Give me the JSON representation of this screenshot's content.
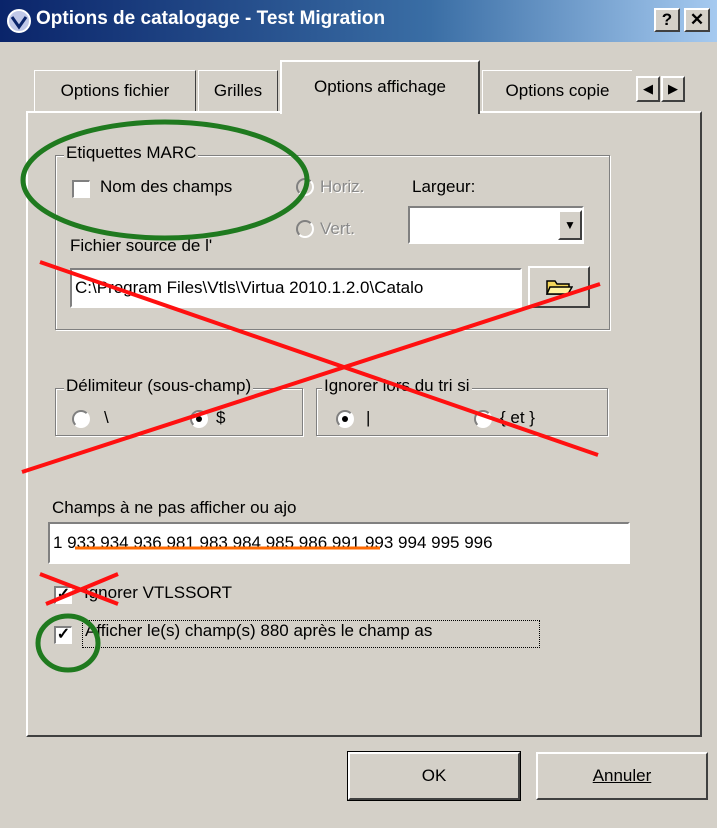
{
  "window": {
    "title": "Options de catalogage - Test Migration",
    "help_label": "?",
    "close_label": "✕"
  },
  "tabs": [
    {
      "label": "Options fichier"
    },
    {
      "label": "Grilles"
    },
    {
      "label": "Options affichage"
    },
    {
      "label": "Options copie"
    }
  ],
  "tab_scroll": {
    "left": "◀",
    "right": "▶"
  },
  "marc_group": {
    "legend": "Etiquettes MARC",
    "field_names_label": "Nom des champs",
    "field_names_checked": false,
    "horiz_label": "Horiz.",
    "vert_label": "Vert.",
    "width_label": "Largeur:",
    "width_value": "",
    "source_file_label": "Fichier source de l'",
    "source_file_value": "C:\\Program Files\\Vtls\\Virtua 2010.1.2.0\\Catalo"
  },
  "delimiter_group": {
    "legend": "Délimiteur (sous-champ)",
    "option_backslash": "\\",
    "option_dollar": "$",
    "selected": "$"
  },
  "ignore_sort_group": {
    "legend": "Ignorer lors du tri si",
    "option_pipe": "|",
    "option_brackets": "{ et }",
    "selected": "|"
  },
  "hidden_fields": {
    "label": "Champs à ne pas afficher ou ajo",
    "value": "1 933 934 936 981 983 984 985 986 991 993 994 995 996"
  },
  "ignore_vtlssort": {
    "label": "Ignorer VTLSSORT",
    "checked": true
  },
  "show_880": {
    "label": "Afficher le(s) champ(s) 880 après le champ as",
    "checked": true
  },
  "buttons": {
    "ok": "OK",
    "cancel": "Annuler"
  },
  "annotation_colors": {
    "green": "#1f7a1f",
    "red": "#ff1010",
    "orange": "#ff6a00"
  }
}
